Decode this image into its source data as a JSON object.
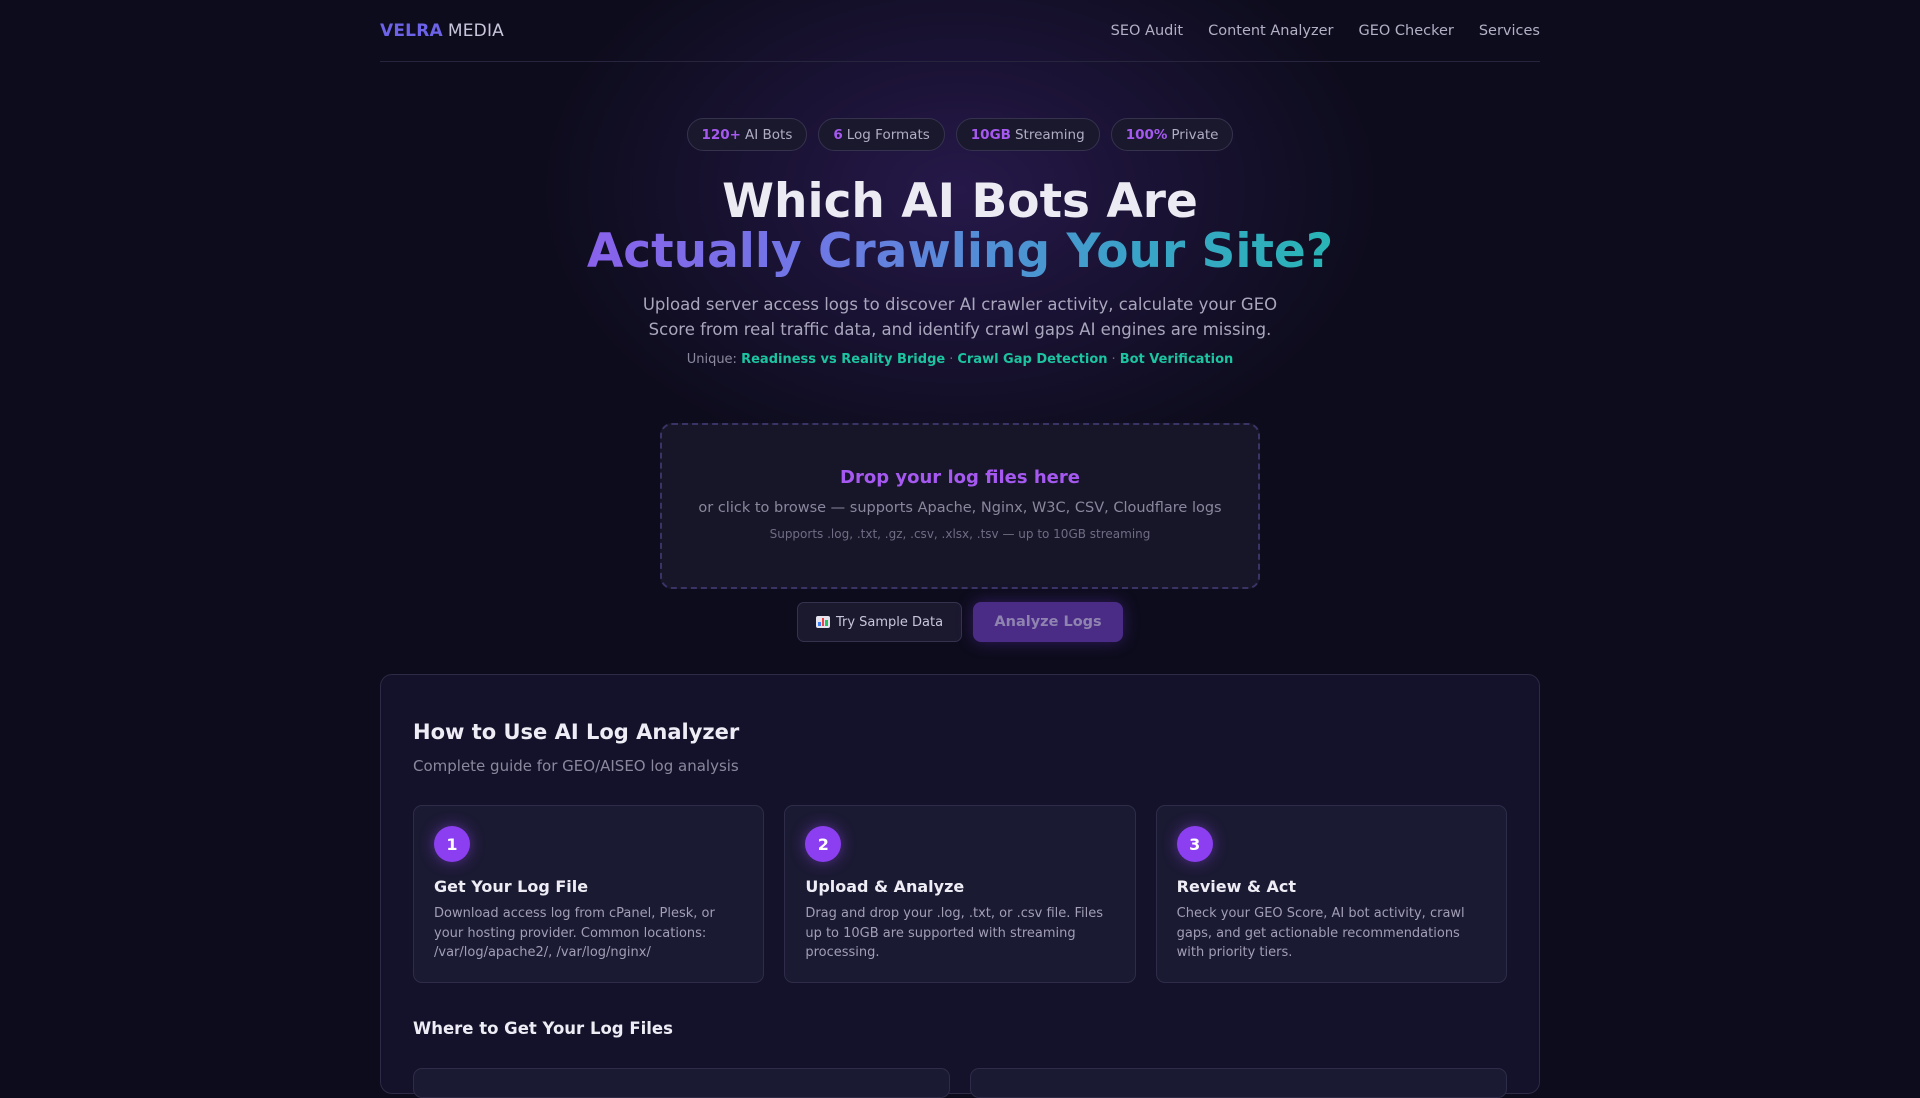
{
  "header": {
    "brand": "VELRA",
    "brand_suffix": "MEDIA",
    "nav": [
      "SEO Audit",
      "Content Analyzer",
      "GEO Checker",
      "Services"
    ]
  },
  "badges": [
    {
      "num": "120+",
      "label": "AI Bots"
    },
    {
      "num": "6",
      "label": "Log Formats"
    },
    {
      "num": "10GB",
      "label": "Streaming"
    },
    {
      "num": "100%",
      "label": "Private"
    }
  ],
  "hero": {
    "title_line1": "Which AI Bots Are",
    "title_line2": "Actually Crawling Your Site?",
    "subtitle_line1": "Upload server access logs to discover AI crawler activity, calculate your GEO",
    "subtitle_line2": "Score from real traffic data, and identify crawl gaps AI engines are missing.",
    "unique_label": "Unique:",
    "unique_items": [
      "Readiness vs Reality Bridge",
      "Crawl Gap Detection",
      "Bot Verification"
    ],
    "separator": "·"
  },
  "dropzone": {
    "title": "Drop your log files here",
    "subtitle": "or click to browse — supports Apache, Nginx, W3C, CSV, Cloudflare logs",
    "note": "Supports .log, .txt, .gz, .csv, .xlsx, .tsv — up to 10GB streaming"
  },
  "actions": {
    "sample_label": "Try Sample Data",
    "analyze_label": "Analyze Logs"
  },
  "guide": {
    "title": "How to Use AI Log Analyzer",
    "subtitle": "Complete guide for GEO/AISEO log analysis",
    "steps": [
      {
        "num": "1",
        "title": "Get Your Log File",
        "desc": "Download access log from cPanel, Plesk, or your hosting provider. Common locations: /var/log/apache2/, /var/log/nginx/"
      },
      {
        "num": "2",
        "title": "Upload & Analyze",
        "desc": "Drag and drop your .log, .txt, or .csv file. Files up to 10GB are supported with streaming processing."
      },
      {
        "num": "3",
        "title": "Review & Act",
        "desc": "Check your GEO Score, AI bot activity, crawl gaps, and get actionable recommendations with priority tiers."
      }
    ],
    "where_title": "Where to Get Your Log Files"
  },
  "colors": {
    "accent_purple": "#a659f0",
    "accent_teal": "#1cc4a0",
    "brand_blue": "#6c63e8"
  }
}
